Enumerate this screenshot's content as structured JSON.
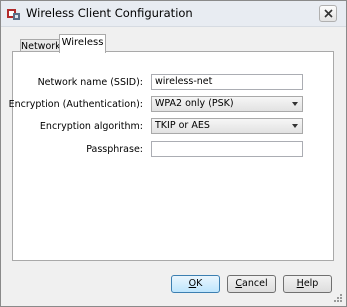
{
  "window": {
    "title": "Wireless Client Configuration"
  },
  "tabs": [
    {
      "label": "Network",
      "active": false
    },
    {
      "label": "Wireless",
      "active": true
    }
  ],
  "form": {
    "ssid": {
      "label": "Network name (SSID):",
      "value": "wireless-net"
    },
    "encryption_auth": {
      "label": "Encryption (Authentication):",
      "value": "WPA2 only (PSK)"
    },
    "encryption_algo": {
      "label": "Encryption algorithm:",
      "value": "TKIP or AES"
    },
    "passphrase": {
      "label": "Passphrase:",
      "value": ""
    }
  },
  "buttons": {
    "ok": {
      "mnemonic": "O",
      "rest": "K"
    },
    "cancel": {
      "mnemonic": "C",
      "rest": "ancel"
    },
    "help": {
      "mnemonic": "H",
      "rest": "elp"
    }
  },
  "colors": {
    "accent": "#3c7fb1",
    "window_bg": "#f0f0f0",
    "panel_bg": "#ffffff"
  }
}
